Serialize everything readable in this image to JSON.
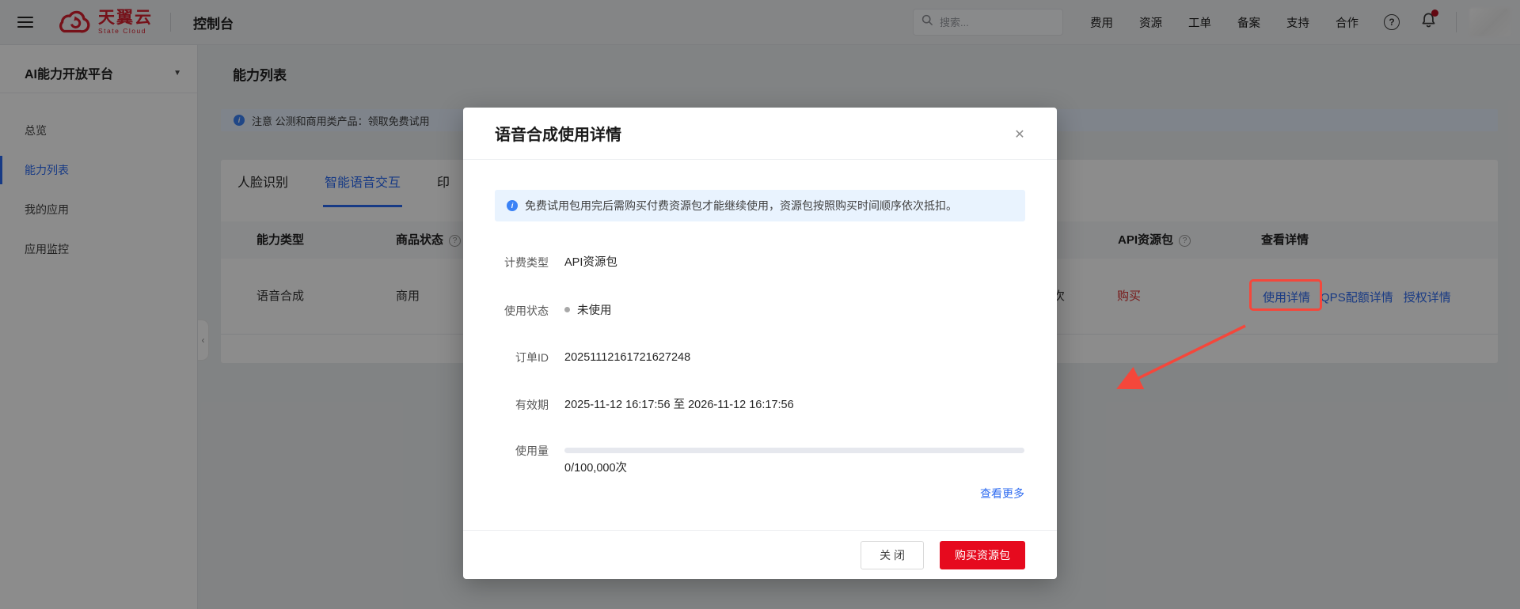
{
  "colors": {
    "brand_red": "#d7202f",
    "accent_red": "#e60a1e",
    "buy_red": "#d92e2e",
    "link_blue": "#2e6bf0",
    "tab_blue": "#2a6af2",
    "info_blue": "#3b82f6",
    "annotation_red": "#f4473b"
  },
  "topbar": {
    "brand": {
      "name": "天翼云",
      "sub": "State Cloud"
    },
    "console": "控制台",
    "search_placeholder": "搜索...",
    "nav": [
      "费用",
      "资源",
      "工单",
      "备案",
      "支持",
      "合作"
    ]
  },
  "sidebar": {
    "title": "AI能力开放平台",
    "items": [
      "总览",
      "能力列表",
      "我的应用",
      "应用监控"
    ]
  },
  "content": {
    "page_title": "能力列表",
    "notice": "注意 公测和商用类产品：领取免费试用",
    "tabs": [
      "人脸识别",
      "智能语音交互",
      "印"
    ],
    "table": {
      "headers": [
        "能力类型",
        "商品状态",
        "API资源包",
        "查看详情"
      ],
      "row": {
        "ability": "语音合成",
        "status": "商用",
        "quota_fragment": "次",
        "buy": "购买",
        "links": [
          "使用详情",
          "QPS配额详情",
          "授权详情"
        ]
      }
    }
  },
  "modal": {
    "title": "语音合成使用详情",
    "notice": "免费试用包用完后需购买付费资源包才能继续使用，资源包按照购买时间顺序依次抵扣。",
    "fields": [
      {
        "label": "计费类型",
        "value": "API资源包"
      },
      {
        "label": "使用状态",
        "value": "未使用"
      },
      {
        "label": "订单ID",
        "value": "20251112161721627248"
      },
      {
        "label": "有效期",
        "value": "2025-11-12 16:17:56 至 2026-11-12 16:17:56"
      }
    ],
    "usage": {
      "label": "使用量",
      "value": "0/100,000次",
      "percent": 0
    },
    "more_link": "查看更多",
    "buttons": {
      "close": "关 闭",
      "buy": "购买资源包"
    }
  },
  "icons": {
    "question": "?",
    "help": "?",
    "caret": "▼",
    "collapse": "‹",
    "close": "✕",
    "info": "i"
  }
}
